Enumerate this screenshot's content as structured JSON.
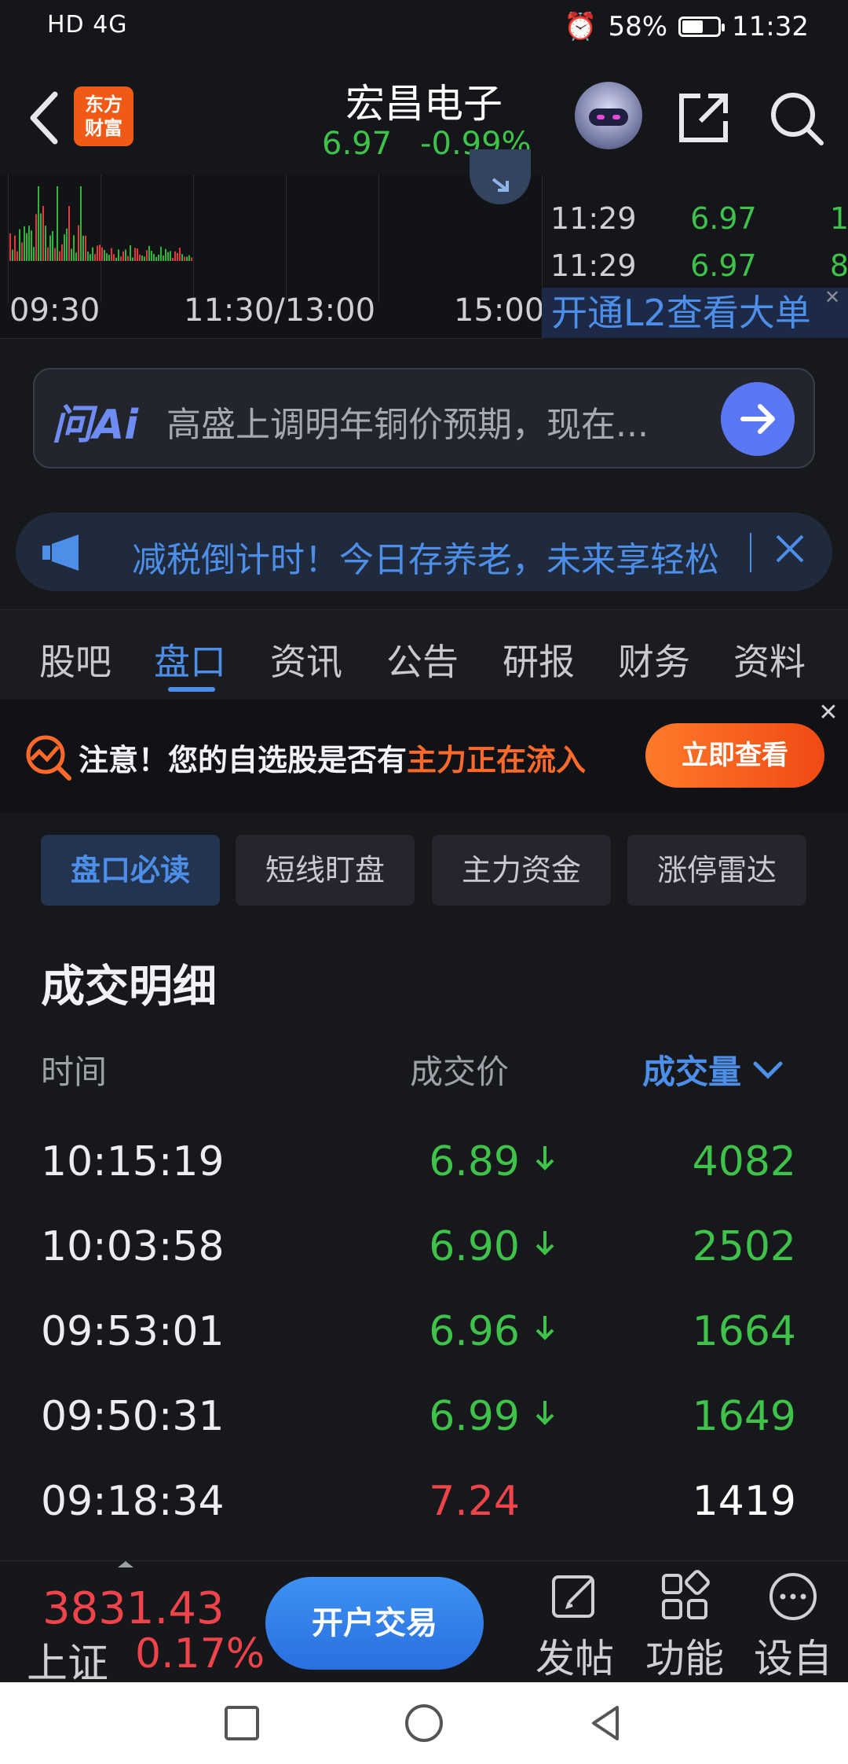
{
  "status_bar": {
    "network": "HD 4G",
    "battery_percent": "58%",
    "battery_level": 0.58,
    "time": "11:32"
  },
  "header": {
    "logo_text": "东方\n财富",
    "stock_name": "宏昌电子",
    "price": "6.97",
    "change_pct": "-0.99%"
  },
  "chart": {
    "time_labels": [
      "09:30",
      "11:30/13:00",
      "15:00"
    ]
  },
  "ticks": [
    {
      "time": "11:29",
      "price": "6.97",
      "vol": "1"
    },
    {
      "time": "11:29",
      "price": "6.97",
      "vol": "8"
    }
  ],
  "l2_banner": "开通L2查看大单",
  "ai_bar": {
    "logo": "问Ai",
    "prompt": "高盛上调明年铜价预期，现在..."
  },
  "notice": {
    "text": "减税倒计时！今日存养老，未来享轻松"
  },
  "tabs": [
    "股吧",
    "盘口",
    "资讯",
    "公告",
    "研报",
    "财务",
    "资料"
  ],
  "active_tab": "盘口",
  "promo": {
    "text_prefix": "注意！您的自选股是否有",
    "text_highlight": "主力正在流入",
    "button": "立即查看"
  },
  "sub_tabs": [
    "盘口必读",
    "短线盯盘",
    "主力资金",
    "涨停雷达"
  ],
  "trade_details": {
    "title": "成交明细",
    "headers": {
      "time": "时间",
      "price": "成交价",
      "volume": "成交量"
    },
    "rows": [
      {
        "time": "10:15:19",
        "price": "6.89",
        "direction": "down",
        "volume": "4082"
      },
      {
        "time": "10:03:58",
        "price": "6.90",
        "direction": "down",
        "volume": "2502"
      },
      {
        "time": "09:53:01",
        "price": "6.96",
        "direction": "down",
        "volume": "1664"
      },
      {
        "time": "09:50:31",
        "price": "6.99",
        "direction": "down",
        "volume": "1649"
      },
      {
        "time": "09:18:34",
        "price": "7.24",
        "direction": "up",
        "volume": "1419"
      }
    ]
  },
  "bottom_bar": {
    "index_value": "3831.43",
    "index_name": "上证",
    "index_pct": "0.17%",
    "trade_button": "开户交易",
    "items": [
      "发帖",
      "功能",
      "设自"
    ]
  },
  "colors": {
    "up": "#f0434a",
    "down": "#3ec24a",
    "accent": "#4d8ee8",
    "background": "#17181c"
  }
}
